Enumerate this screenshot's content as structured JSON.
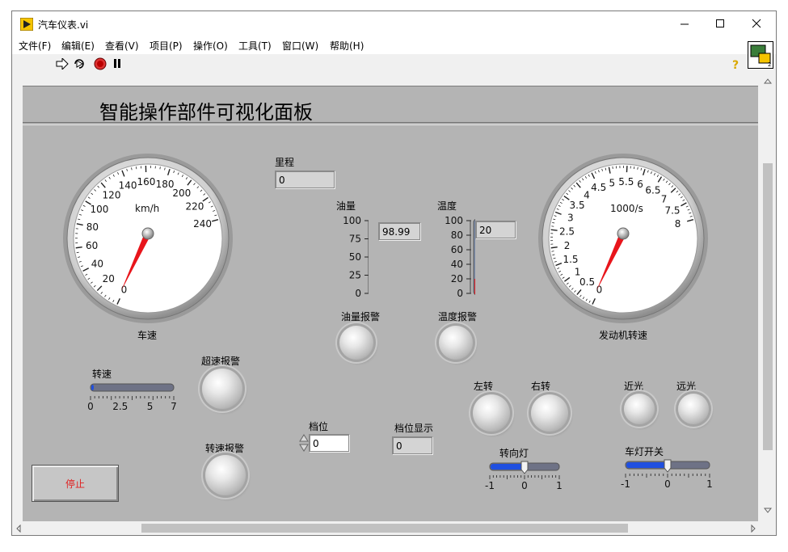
{
  "window": {
    "title": "汽车仪表.vi",
    "icon": "labview-vi-icon",
    "controls": {
      "minimize": "minimize-icon",
      "maximize": "maximize-icon",
      "close": "close-icon"
    }
  },
  "menu": [
    "文件(F)",
    "编辑(E)",
    "查看(V)",
    "项目(P)",
    "操作(O)",
    "工具(T)",
    "窗口(W)",
    "帮助(H)"
  ],
  "toolbar": [
    "run-arrow-icon",
    "run-continuously-icon",
    "abort-icon",
    "pause-icon",
    "help-icon"
  ],
  "panel": {
    "title": "智能操作部件可视化面板",
    "speed_gauge": {
      "label": "车速",
      "unit": "km/h",
      "ticks": [
        "0",
        "20",
        "40",
        "60",
        "80",
        "100",
        "120",
        "140",
        "160",
        "180",
        "200",
        "220",
        "240"
      ],
      "value": 0
    },
    "rpm_gauge": {
      "label": "发动机转速",
      "unit": "1000/s",
      "ticks": [
        "0",
        "0.5",
        "1",
        "1.5",
        "2",
        "2.5",
        "3",
        "3.5",
        "4",
        "4.5",
        "5",
        "5.5",
        "6",
        "6.5",
        "7",
        "7.5",
        "8"
      ],
      "value": 0
    },
    "mileage": {
      "label": "里程",
      "value": "0"
    },
    "fuel": {
      "label": "油量",
      "ticks": [
        "100",
        "75",
        "50",
        "25",
        "0"
      ],
      "value": "98.99",
      "level": 98.99,
      "alarm_label": "油量报警"
    },
    "temperature": {
      "label": "温度",
      "ticks": [
        "100",
        "80",
        "60",
        "40",
        "20",
        "0"
      ],
      "value": "20",
      "level": 20,
      "alarm_label": "温度报警"
    },
    "rotation_slider": {
      "label": "转速",
      "ticks": [
        "0",
        "2.5",
        "5",
        "7"
      ],
      "value": 0
    },
    "overspeed_alarm": {
      "label": "超速报警"
    },
    "rpm_alarm": {
      "label": "转速报警"
    },
    "gear": {
      "label": "档位",
      "value": "0"
    },
    "gear_display": {
      "label": "档位显示",
      "value": "0"
    },
    "left_turn": {
      "label": "左转"
    },
    "right_turn": {
      "label": "右转"
    },
    "low_beam": {
      "label": "近光"
    },
    "high_beam": {
      "label": "远光"
    },
    "turn_signal": {
      "label": "转向灯",
      "ticks": [
        "-1",
        "0",
        "1"
      ],
      "value": 0
    },
    "light_switch": {
      "label": "车灯开关",
      "ticks": [
        "-1",
        "0",
        "1"
      ],
      "value": 0
    },
    "stop_button": {
      "label": "停止"
    }
  },
  "colors": {
    "panel_bg": "#b4b4b4",
    "needle": "#e8151b",
    "fuel_fill": "#1f4fe0",
    "temp_fill": "#e2191f",
    "slider_fill": "#1f4fe0",
    "stop_text": "#e02020"
  }
}
